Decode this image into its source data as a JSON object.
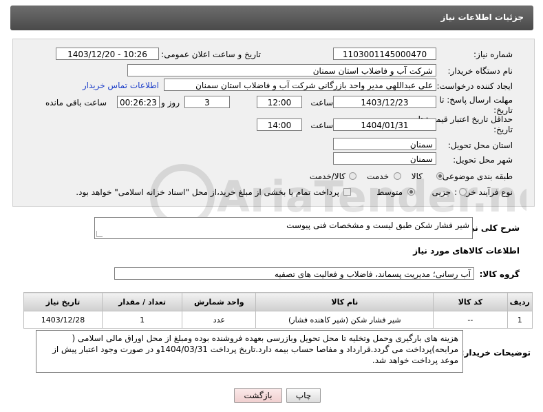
{
  "header": {
    "title": "جزئیات اطلاعات نیاز"
  },
  "fields": {
    "need_number_label": "شماره نیاز:",
    "need_number": "1103001145000470",
    "announce_label": "تاریخ و ساعت اعلان عمومی:",
    "announce_value": "1403/12/20 - 10:26",
    "buyer_org_label": "نام دستگاه خریدار:",
    "buyer_org": "شرکت آب و فاضلاب استان سمنان",
    "creator_label": "ایجاد کننده درخواست:",
    "creator": "علی عبداللهی مدیر واحد بازرگانی شرکت آب و فاضلاب استان سمنان",
    "contact_link": "اطلاعات تماس خریدار",
    "deadline_label": "مهلت ارسال پاسخ: تا تاریخ:",
    "deadline_date": "1403/12/23",
    "time_label": "ساعت",
    "deadline_time": "12:00",
    "days_value": "3",
    "days_label": "روز و",
    "remaining_time": "00:26:23",
    "remaining_label": "ساعت باقی مانده",
    "min_valid_label": "حداقل تاریخ اعتبار قیمت: تا تاریخ:",
    "min_valid_date": "1404/01/31",
    "min_valid_time": "14:00",
    "province_label": "استان محل تحویل:",
    "province": "سمنان",
    "city_label": "شهر محل تحویل:",
    "city": "سمنان",
    "category_label": "طبقه بندی موضوعی:",
    "category_options": [
      "کالا",
      "خدمت",
      "کالا/خدمت"
    ],
    "process_label": "نوع فرآیند خرید :",
    "process_options": [
      "جزیی",
      "متوسط"
    ],
    "payment_note": "پرداخت تمام یا بخشی از مبلغ خرید،از محل \"اسناد خزانه اسلامی\" خواهد بود."
  },
  "description": {
    "label": "شرح کلی نیاز:",
    "value": "شیر فشار شکن طبق لیست و مشخصات فنی پیوست"
  },
  "goods_section": {
    "title": "اطلاعات کالاهای مورد نیاز",
    "group_label": "گروه کالا:",
    "group_value": "آب رسانی؛ مدیریت پسماند، فاضلاب و فعالیت های تصفیه"
  },
  "table": {
    "headers": [
      "ردیف",
      "کد کالا",
      "نام کالا",
      "واحد شمارش",
      "تعداد / مقدار",
      "تاریخ نیاز"
    ],
    "rows": [
      [
        "1",
        "--",
        "شیر فشار شکن (شیر کاهنده فشار)",
        "عدد",
        "1",
        "1403/12/28"
      ]
    ]
  },
  "buyer_notes": {
    "label": "توضیحات خریدار:",
    "value": "هزینه های بارگیری وحمل وتخلیه تا محل تحویل وبازرسی بعهده فروشنده بوده ومبلغ از محل اوراق مالی اسلامی ( مرابحه)پرداخت می گردد.قرارداد و مفاصا حساب بیمه دارد.تاریخ پرداخت 1404/03/31و در صورت وجود اعتبار پیش از موعد پرداخت خواهد شد."
  },
  "buttons": {
    "print": "چاپ",
    "back": "بازگشت"
  },
  "watermark": "AriaTender.neT",
  "colors": {
    "header_bg": "#5a5a5a",
    "link": "#1a3cc8",
    "back_button_bg": "#f6dcdc"
  }
}
